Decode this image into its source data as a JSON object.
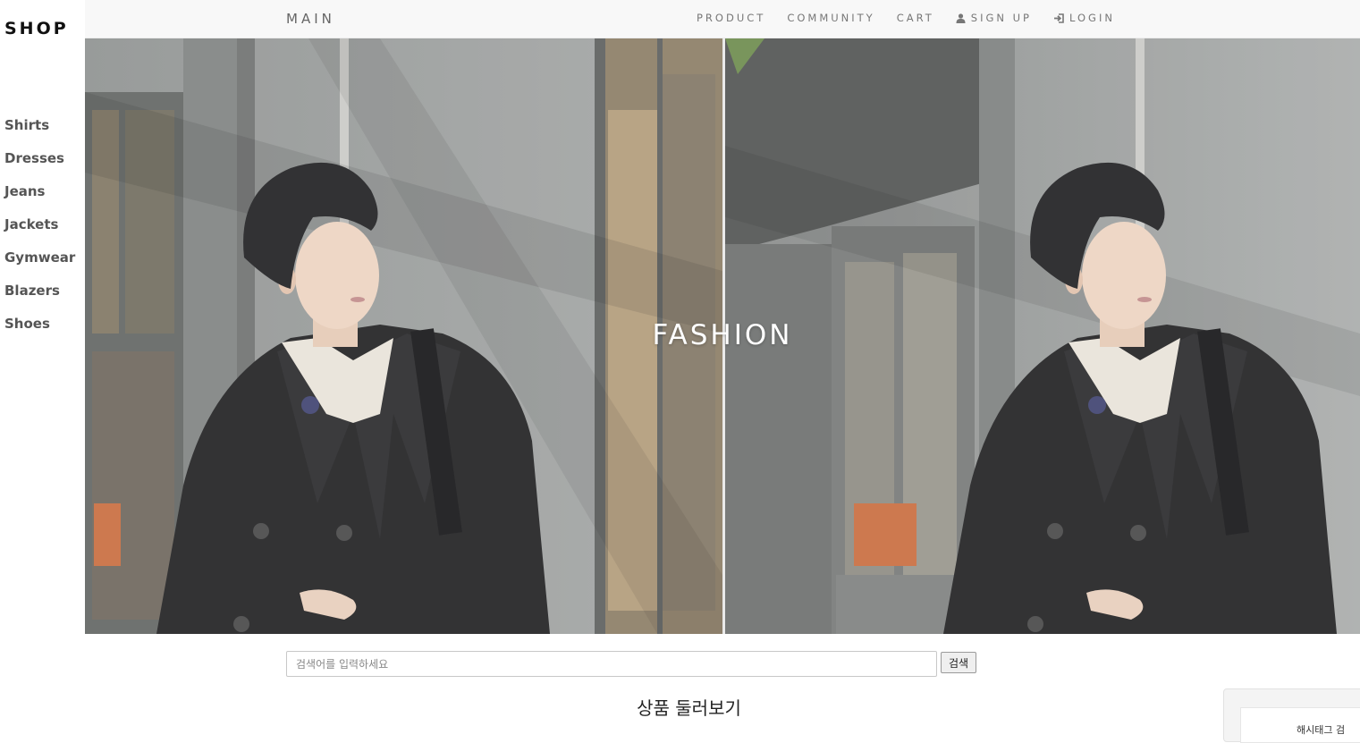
{
  "sidebar": {
    "brand": "SHOP",
    "categories": [
      "Shirts",
      "Dresses",
      "Jeans",
      "Jackets",
      "Gymwear",
      "Blazers",
      "Shoes"
    ]
  },
  "nav": {
    "main": "MAIN",
    "product": "PRODUCT",
    "community": "COMMUNITY",
    "cart": "CART",
    "signup": "SIGN UP",
    "login": "LOGIN",
    "signup_icon": "user-icon",
    "login_icon": "login-icon"
  },
  "hero": {
    "title": "FASHION"
  },
  "search": {
    "placeholder": "검색어를 입력하세요",
    "value": "",
    "button_label": "검색"
  },
  "section": {
    "title": "상품 둘러보기"
  },
  "corner_card": {
    "text": "해시태그 검"
  },
  "colors": {
    "nav_bg": "#f8f8f8",
    "nav_text": "#777777",
    "sidebar_text": "#555555",
    "brand_text": "#111111",
    "hero_text": "#ffffff"
  }
}
